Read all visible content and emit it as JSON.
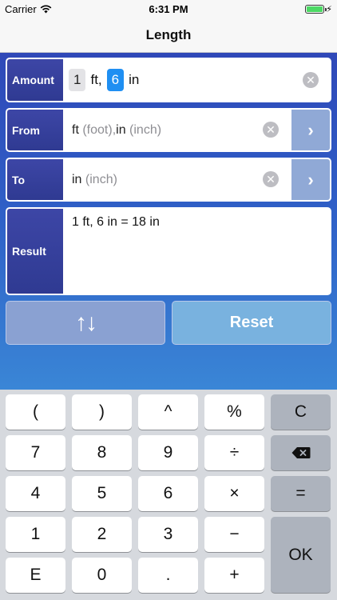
{
  "status_bar": {
    "carrier": "Carrier",
    "time": "6:31 PM",
    "wifi_icon": "wifi-icon",
    "battery_icon": "battery-icon",
    "charging_icon": "bolt-icon"
  },
  "nav": {
    "title": "Length"
  },
  "amount": {
    "label": "Amount",
    "part1_value": "1",
    "part1_unit": "ft,",
    "part2_value": "6",
    "part2_unit": "in"
  },
  "from": {
    "label": "From",
    "unit_short": "ft",
    "unit_hint": "(foot), ",
    "unit_short2": "in",
    "unit_hint2": "(inch)"
  },
  "to": {
    "label": "To",
    "unit_short": "in",
    "unit_hint": "(inch)"
  },
  "result": {
    "label": "Result",
    "text": "1 ft, 6 in = 18 in"
  },
  "actions": {
    "swap_label": "↑↓",
    "reset_label": "Reset"
  },
  "icons": {
    "clear": "✕",
    "chevron": "›"
  },
  "keypad": {
    "open_paren": "(",
    "close_paren": ")",
    "caret": "^",
    "percent": "%",
    "clear": "C",
    "seven": "7",
    "eight": "8",
    "nine": "9",
    "divide": "÷",
    "backspace": "⌫",
    "four": "4",
    "five": "5",
    "six": "6",
    "multiply": "×",
    "equals": "=",
    "one": "1",
    "two": "2",
    "three": "3",
    "minus": "−",
    "ok": "OK",
    "exp": "E",
    "zero": "0",
    "dot": ".",
    "plus": "+"
  },
  "colors": {
    "label_bg": "#2f3a92",
    "blue_gradient_top": "#2f48b8",
    "blue_gradient_bottom": "#3a86d6",
    "chip_blue": "#1f8ff2",
    "arrow_button": "#90a9d6"
  }
}
